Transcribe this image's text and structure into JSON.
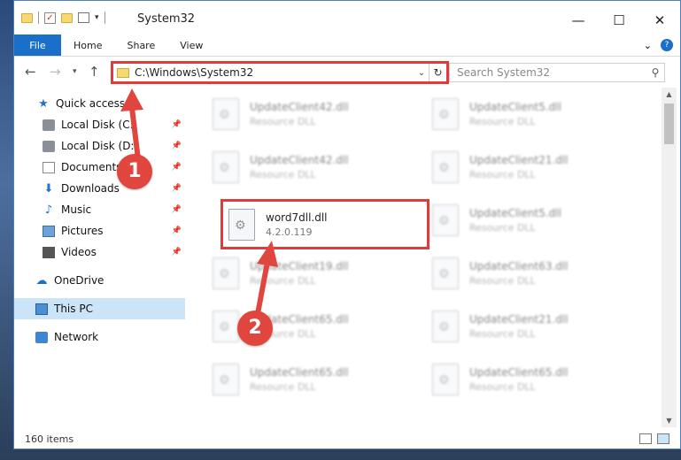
{
  "window": {
    "title": "System32"
  },
  "ribbon": {
    "tabs": [
      "File",
      "Home",
      "Share",
      "View"
    ]
  },
  "address": {
    "path": "C:\\Windows\\System32"
  },
  "search": {
    "placeholder": "Search System32"
  },
  "sidebar": {
    "items": [
      {
        "label": "Quick access",
        "icon": "star-icon",
        "pinned": false
      },
      {
        "label": "Local Disk (C:)",
        "icon": "disk-icon",
        "pinned": true
      },
      {
        "label": "Local Disk (D:)",
        "icon": "disk-icon",
        "pinned": true
      },
      {
        "label": "Documents",
        "icon": "documents-icon",
        "pinned": true
      },
      {
        "label": "Downloads",
        "icon": "downloads-icon",
        "pinned": true
      },
      {
        "label": "Music",
        "icon": "music-icon",
        "pinned": true
      },
      {
        "label": "Pictures",
        "icon": "pictures-icon",
        "pinned": true
      },
      {
        "label": "Videos",
        "icon": "videos-icon",
        "pinned": true
      },
      {
        "label": "OneDrive",
        "icon": "onedrive-icon",
        "pinned": false
      },
      {
        "label": "This PC",
        "icon": "pc-icon",
        "pinned": false,
        "selected": true
      },
      {
        "label": "Network",
        "icon": "network-icon",
        "pinned": false
      }
    ]
  },
  "files": {
    "left": [
      {
        "name": "UpdateClient42.dll",
        "sub": "Resource DLL"
      },
      {
        "name": "UpdateClient42.dll",
        "sub": "Resource DLL"
      },
      {
        "name": "word7dll.dll",
        "sub": "4.2.0.119",
        "highlighted": true
      },
      {
        "name": "UpdateClient19.dll",
        "sub": "Resource DLL"
      },
      {
        "name": "UpdateClient65.dll",
        "sub": "Resource DLL"
      },
      {
        "name": "UpdateClient65.dll",
        "sub": "Resource DLL"
      }
    ],
    "right": [
      {
        "name": "UpdateClient5.dll",
        "sub": "Resource DLL"
      },
      {
        "name": "UpdateClient21.dll",
        "sub": "Resource DLL"
      },
      {
        "name": "UpdateClient5.dll",
        "sub": "Resource DLL"
      },
      {
        "name": "UpdateClient63.dll",
        "sub": "Resource DLL"
      },
      {
        "name": "UpdateClient21.dll",
        "sub": "Resource DLL"
      },
      {
        "name": "UpdateClient65.dll",
        "sub": "Resource DLL"
      }
    ]
  },
  "status": {
    "items_count": "160 items"
  },
  "annotations": {
    "step1": "1",
    "step2": "2",
    "color": "#e0463d"
  }
}
